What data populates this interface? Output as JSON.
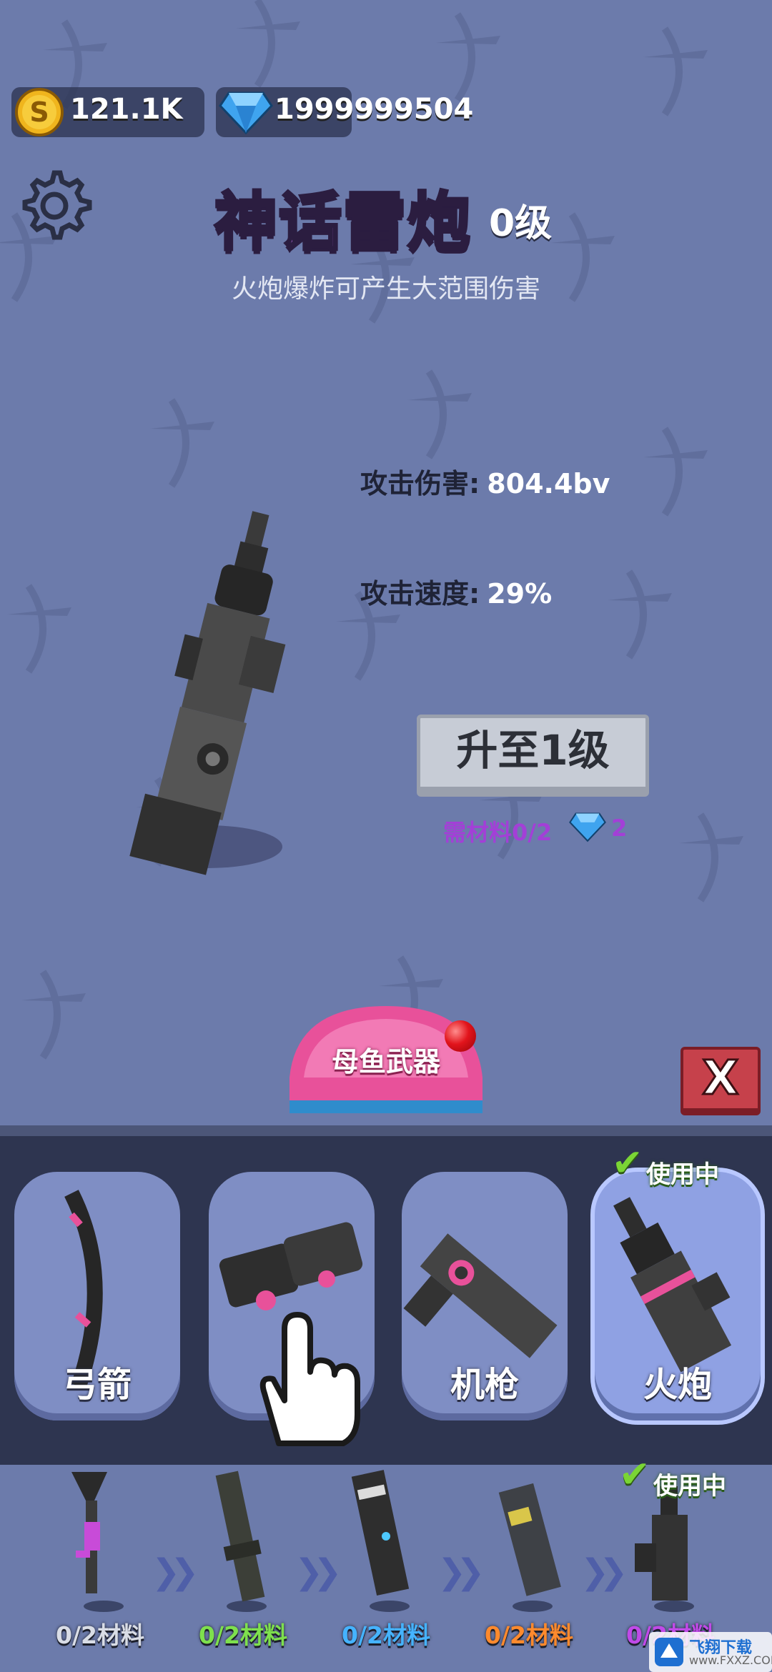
{
  "resources": {
    "coins": "121.1K",
    "gems": "1999999504"
  },
  "weapon": {
    "name": "神话雷炮",
    "level": "0级",
    "description": "火炮爆炸可产生大范围伤害",
    "stats": [
      {
        "label": "攻击伤害:",
        "value": "804.4bv"
      },
      {
        "label": "攻击速度:",
        "value": "29%"
      }
    ],
    "upgrade_label": "升至1级",
    "requirement": "需材料0/2",
    "gem_cost": "2"
  },
  "mother_weapon_label": "母鱼武器",
  "close_label": "X",
  "categories": [
    {
      "label": "弓箭",
      "active": false
    },
    {
      "label": "",
      "active": false
    },
    {
      "label": "机枪",
      "active": false
    },
    {
      "label": "火炮",
      "active": true
    }
  ],
  "in_use_label": "使用中",
  "tiers": [
    {
      "label": "0/2材料",
      "color": "#d9dde6"
    },
    {
      "label": "0/2材料",
      "color": "#7ee04d"
    },
    {
      "label": "0/2材料",
      "color": "#45b3ff"
    },
    {
      "label": "0/2材料",
      "color": "#ff8a2d"
    },
    {
      "label": "0/2材料",
      "color": "#c04ae8"
    }
  ],
  "watermark": {
    "name": "飞翔下载",
    "url": "www.FXXZ.COM"
  },
  "colors": {
    "background": "#6c7bab",
    "title": "#b06ad8",
    "panel": "#2e3550",
    "accent_pink": "#e8519a"
  }
}
